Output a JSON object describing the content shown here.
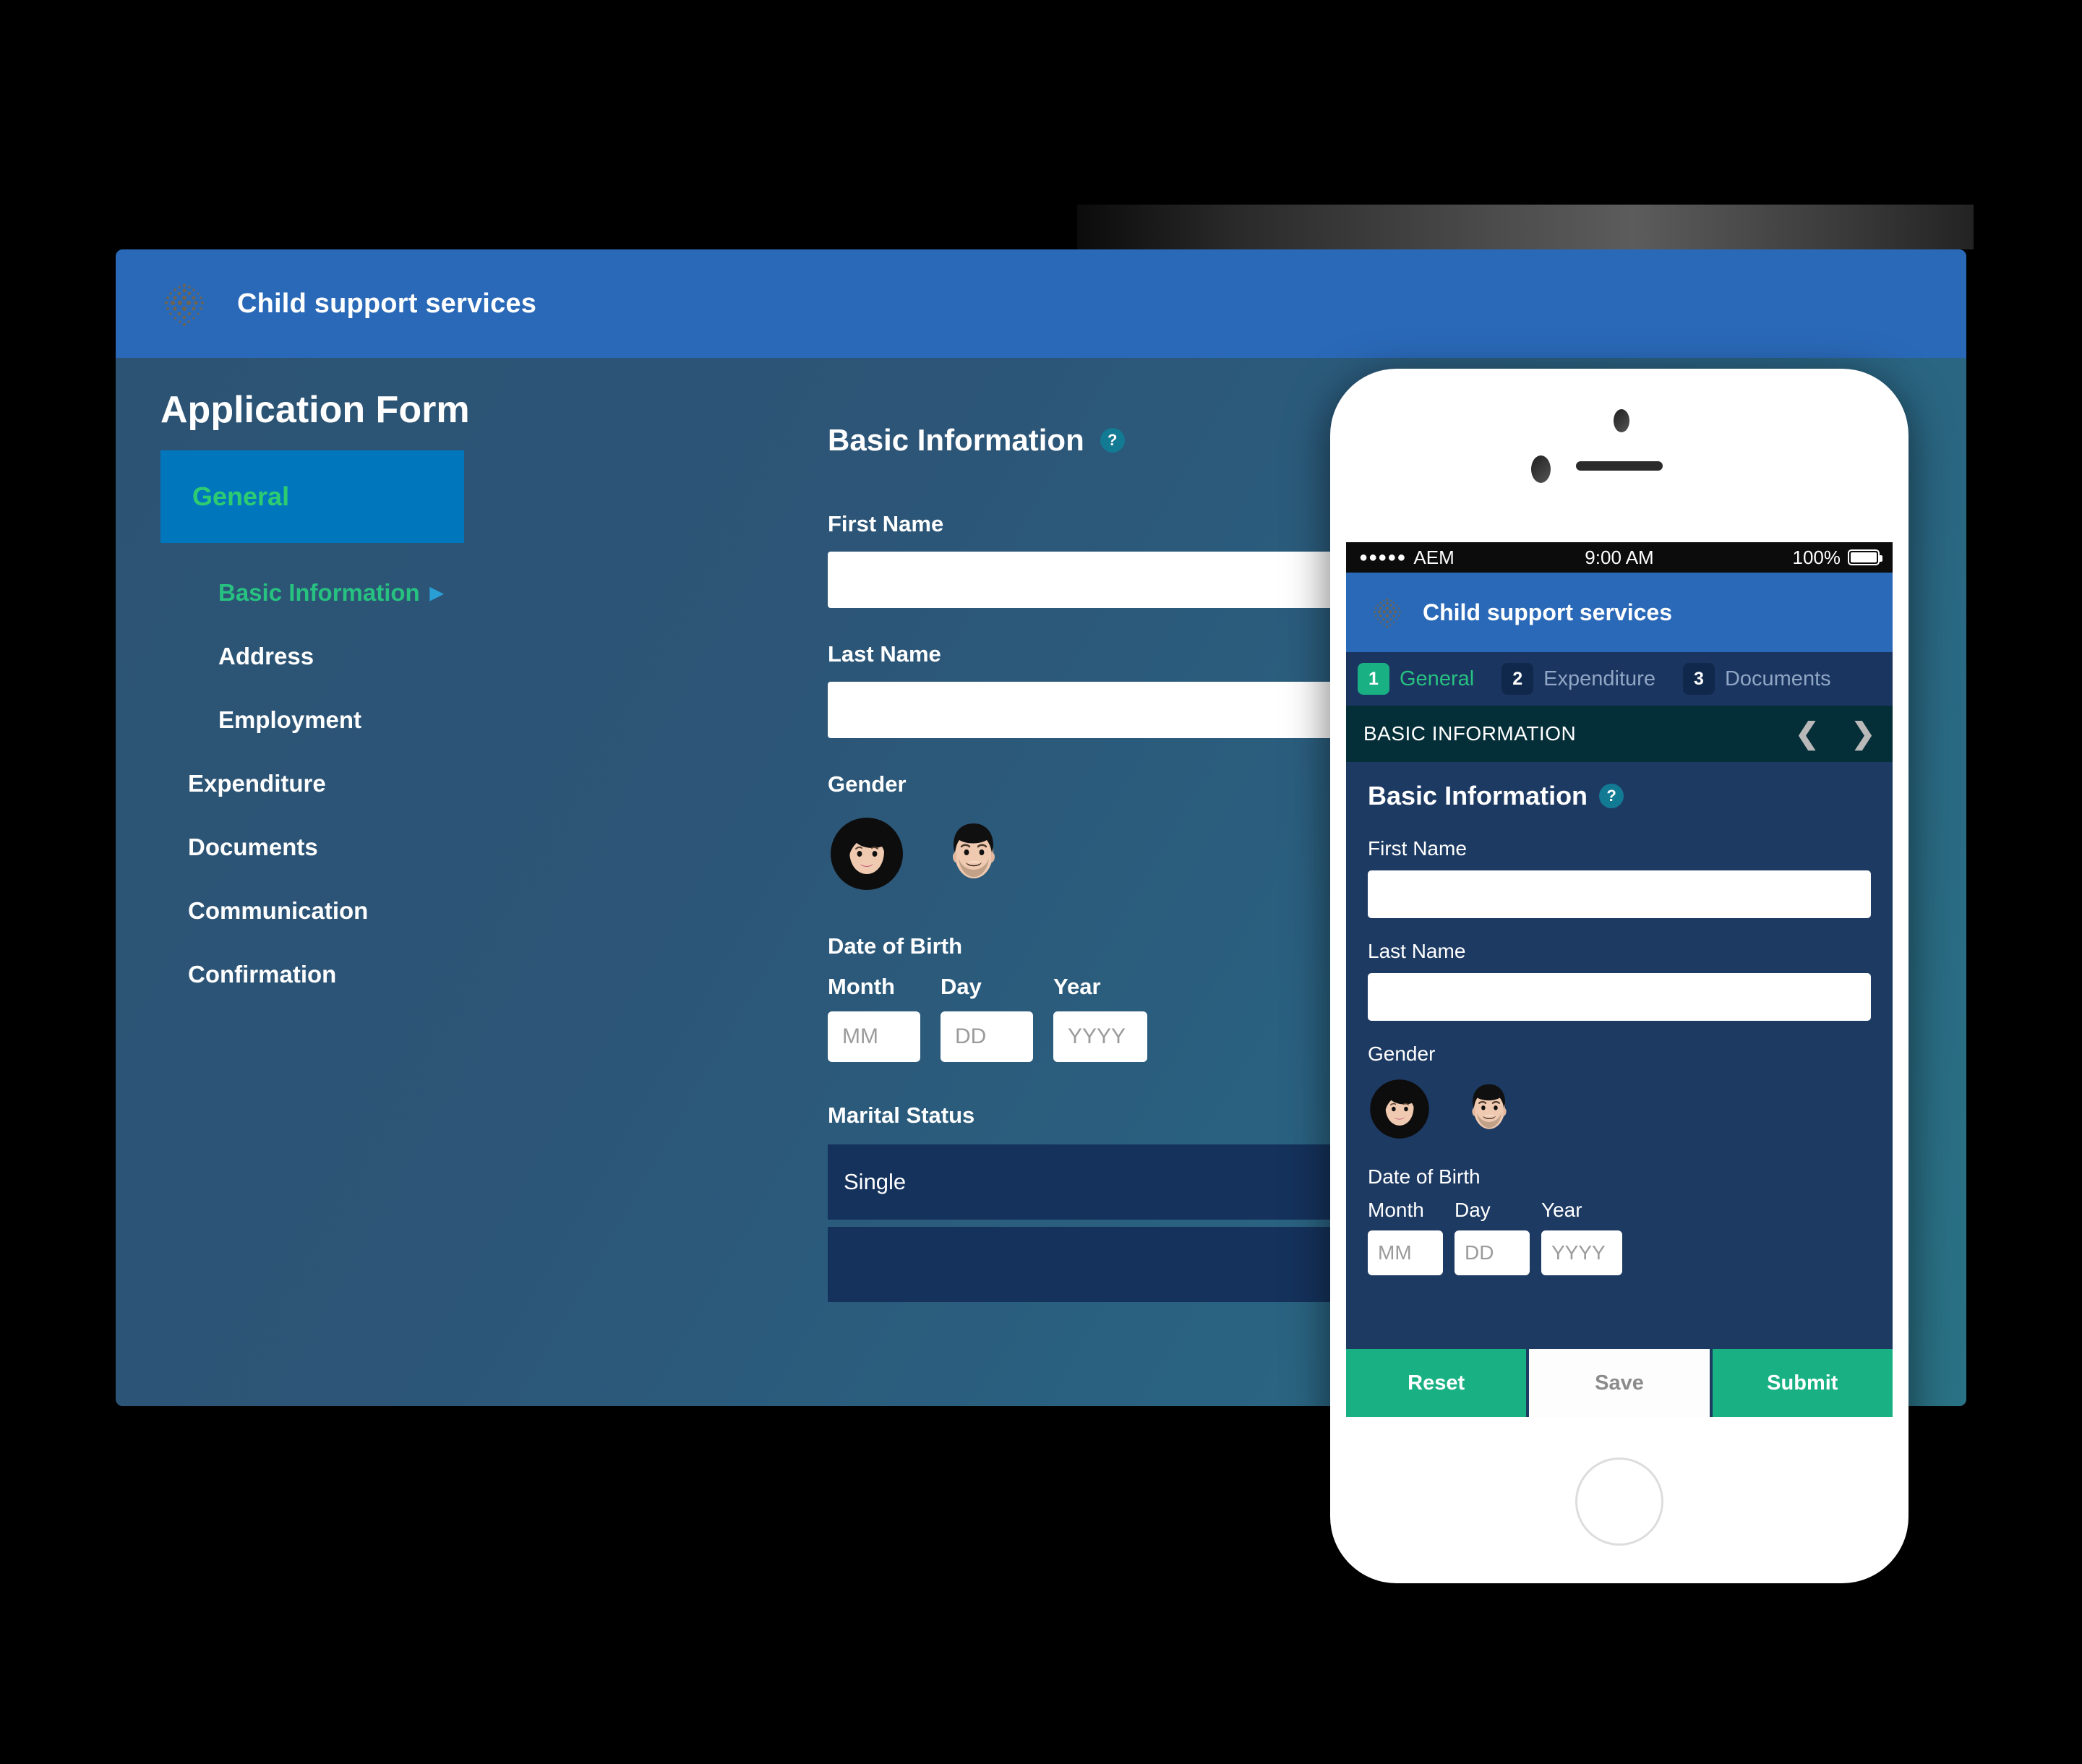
{
  "desktop": {
    "header": {
      "logo_icon": "halftone-dots-logo",
      "brand": "Child support services"
    },
    "page_title": "Application Form",
    "sidebar": {
      "active_section": "General",
      "sub_items": [
        {
          "label": "Basic Information",
          "active": true,
          "caret": "▶"
        },
        {
          "label": "Address",
          "active": false
        },
        {
          "label": "Employment",
          "active": false
        }
      ],
      "items": [
        {
          "label": "Expenditure"
        },
        {
          "label": "Documents"
        },
        {
          "label": "Communication"
        },
        {
          "label": "Confirmation"
        }
      ]
    },
    "form": {
      "section_title": "Basic Information",
      "help_badge": "?",
      "first_name": {
        "label": "First Name",
        "value": "",
        "placeholder": ""
      },
      "last_name": {
        "label": "Last Name",
        "value": "",
        "placeholder": ""
      },
      "gender": {
        "label": "Gender",
        "options": [
          "female-avatar",
          "male-avatar"
        ]
      },
      "dob": {
        "label": "Date of Birth",
        "month": {
          "label": "Month",
          "placeholder": "MM",
          "value": ""
        },
        "day": {
          "label": "Day",
          "placeholder": "DD",
          "value": ""
        },
        "year": {
          "label": "Year",
          "placeholder": "YYYY",
          "value": ""
        }
      },
      "marital_status": {
        "label": "Marital Status",
        "options": [
          "Single"
        ]
      }
    }
  },
  "phone": {
    "status_bar": {
      "signal": "●●●●●",
      "carrier": "AEM",
      "time": "9:00 AM",
      "battery": "100%"
    },
    "header": {
      "logo_icon": "halftone-dots-logo",
      "brand": "Child support services"
    },
    "tabs": [
      {
        "num": "1",
        "label": "General",
        "active": true
      },
      {
        "num": "2",
        "label": "Expenditure",
        "active": false
      },
      {
        "num": "3",
        "label": "Documents",
        "active": false
      }
    ],
    "breadcrumb": {
      "text": "BASIC INFORMATION",
      "prev_icon": "❮",
      "next_icon": "❯"
    },
    "form": {
      "section_title": "Basic Information",
      "help_badge": "?",
      "first_name": {
        "label": "First Name",
        "value": ""
      },
      "last_name": {
        "label": "Last Name",
        "value": ""
      },
      "gender": {
        "label": "Gender"
      },
      "dob": {
        "label": "Date of Birth",
        "month": {
          "label": "Month",
          "placeholder": "MM"
        },
        "day": {
          "label": "Day",
          "placeholder": "DD"
        },
        "year": {
          "label": "Year",
          "placeholder": "YYYY"
        }
      }
    },
    "actions": {
      "reset": "Reset",
      "save": "Save",
      "submit": "Submit"
    }
  },
  "colors": {
    "brand_blue": "#2a69b8",
    "accent_green": "#19b183",
    "active_blue": "#0077bd",
    "panel_navy": "#1d3a63",
    "crumb_dark": "#052f38"
  }
}
